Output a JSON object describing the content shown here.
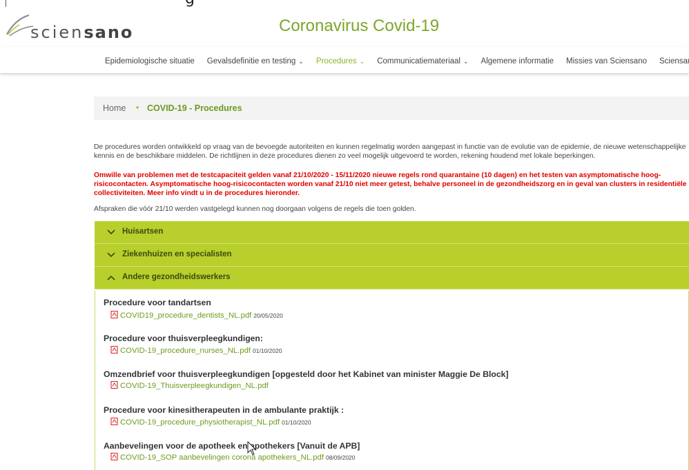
{
  "top_cut_text": "g",
  "logo": {
    "part1": "scien",
    "part2": "sano"
  },
  "site_title": "Coronavirus Covid-19",
  "nav": {
    "items": [
      {
        "label": "Epidemiologische situatie",
        "dropdown": false,
        "active": false
      },
      {
        "label": "Gevalsdefinitie en testing",
        "dropdown": true,
        "active": false
      },
      {
        "label": "Procedures",
        "dropdown": true,
        "active": true
      },
      {
        "label": "Communicatiemateriaal",
        "dropdown": true,
        "active": false
      },
      {
        "label": "Algemene informatie",
        "dropdown": false,
        "active": false
      },
      {
        "label": "Missies van Sciensano",
        "dropdown": false,
        "active": false
      },
      {
        "label": "Sciensano projec",
        "dropdown": false,
        "active": false
      }
    ]
  },
  "breadcrumb": {
    "home": "Home",
    "separator": "•",
    "current": "COVID-19 - Procedures"
  },
  "intro": "De procedures worden ontwikkeld op vraag van de bevoegde autoriteiten en kunnen regelmatig worden aangepast in functie van de evolutie van de epidemie, de nieuwe wetenschappelijke kennis en de beschikbare middelen. De richtlijnen in deze procedures dienen zo veel mogelijk uitgevoerd te worden, rekening houdend met lokale beperkingen.",
  "warning": "Omwille van problemen met de testcapaciteit gelden vanaf 21/10/2020 - 15/11/2020 nieuwe regels rond quarantaine (10 dagen) en het testen van asymptomatische hoog-risicocontacten. Asymptomatische hoog-risicocontacten worden vanaf 21/10 niet meer getest, behalve personeel in de gezondheidszorg en in geval van clusters in residentiële collectiviteiten. Meer info vindt u in de procedures hieronder.",
  "note": "Afspraken die vóór 21/10 werden vastgelegd kunnen nog doorgaan volgens de regels die toen golden.",
  "accordion": [
    {
      "label": "Huisartsen",
      "expanded": false
    },
    {
      "label": "Ziekenhuizen en specialisten",
      "expanded": false
    },
    {
      "label": "Andere gezondheidswerkers",
      "expanded": true
    }
  ],
  "items": [
    {
      "title": "Procedure voor tandartsen",
      "file": "COVID19_procedure_dentists_NL.pdf",
      "date": "20/05/2020"
    },
    {
      "title": "Procedure voor thuisverpleegkundigen:",
      "file": "COVID-19_procedure_nurses_NL.pdf",
      "date": "01/10/2020"
    },
    {
      "title": "Omzendbrief voor thuisverpleegkundigen [opgesteld door het Kabinet van minister Maggie De Block]",
      "file": "COVID-19_Thuisverpleegkundigen_NL.pdf",
      "date": ""
    },
    {
      "title": "Procedure voor kinesitherapeuten in de ambulante praktijk :",
      "file": "COVID-19_procedure_physiotherapist_NL.pdf",
      "date": "01/10/2020"
    },
    {
      "title": "Aanbevelingen voor de apotheek en apothekers [Vanuit de APB]",
      "file": "COVID-19_SOP aanbevelingen corona apothekers_NL.pdf",
      "date": "08/09/2020"
    }
  ],
  "colors": {
    "brand_green": "#7da62a",
    "accordion_bg": "#b9cf2c",
    "warning_red": "#e00000",
    "pdf_red": "#d9262b"
  }
}
